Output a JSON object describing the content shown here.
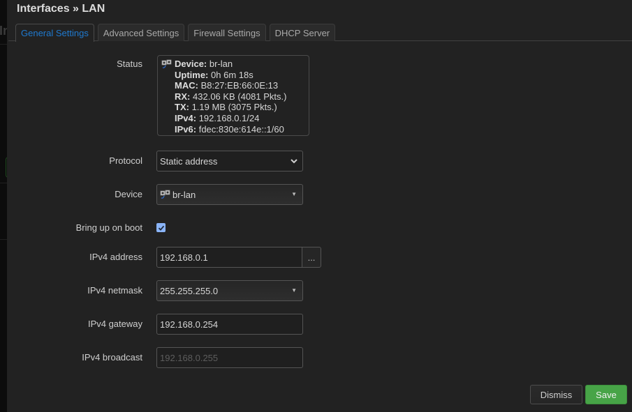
{
  "background": {
    "hint_text": "In"
  },
  "modal": {
    "title": "Interfaces » LAN",
    "tabs": [
      {
        "label": "General Settings",
        "active": true
      },
      {
        "label": "Advanced Settings",
        "active": false
      },
      {
        "label": "Firewall Settings",
        "active": false
      },
      {
        "label": "DHCP Server",
        "active": false
      }
    ],
    "fields": {
      "status": {
        "label": "Status",
        "icon": "ethernet-bridge-icon",
        "lines": [
          {
            "key": "Device:",
            "value": "br-lan"
          },
          {
            "key": "Uptime:",
            "value": "0h 6m 18s"
          },
          {
            "key": "MAC:",
            "value": "B8:27:EB:66:0E:13"
          },
          {
            "key": "RX:",
            "value": "432.06 KB (4081 Pkts.)"
          },
          {
            "key": "TX:",
            "value": "1.19 MB (3075 Pkts.)"
          },
          {
            "key": "IPv4:",
            "value": "192.168.0.1/24"
          },
          {
            "key": "IPv6:",
            "value": "fdec:830e:614e::1/60"
          }
        ]
      },
      "protocol": {
        "label": "Protocol",
        "value": "Static address"
      },
      "device": {
        "label": "Device",
        "value": "br-lan",
        "icon": "ethernet-bridge-icon"
      },
      "bring_up_on_boot": {
        "label": "Bring up on boot",
        "checked": true
      },
      "ipv4_address": {
        "label": "IPv4 address",
        "value": "192.168.0.1",
        "addon": "..."
      },
      "ipv4_netmask": {
        "label": "IPv4 netmask",
        "value": "255.255.255.0"
      },
      "ipv4_gateway": {
        "label": "IPv4 gateway",
        "value": "192.168.0.254"
      },
      "ipv4_broadcast": {
        "label": "IPv4 broadcast",
        "value": "",
        "placeholder": "192.168.0.255"
      }
    },
    "buttons": {
      "dismiss": "Dismiss",
      "save": "Save"
    },
    "colors": {
      "accent": "#1f7ad0",
      "save": "#47a447",
      "checkbox": "#8ab4f8"
    }
  }
}
